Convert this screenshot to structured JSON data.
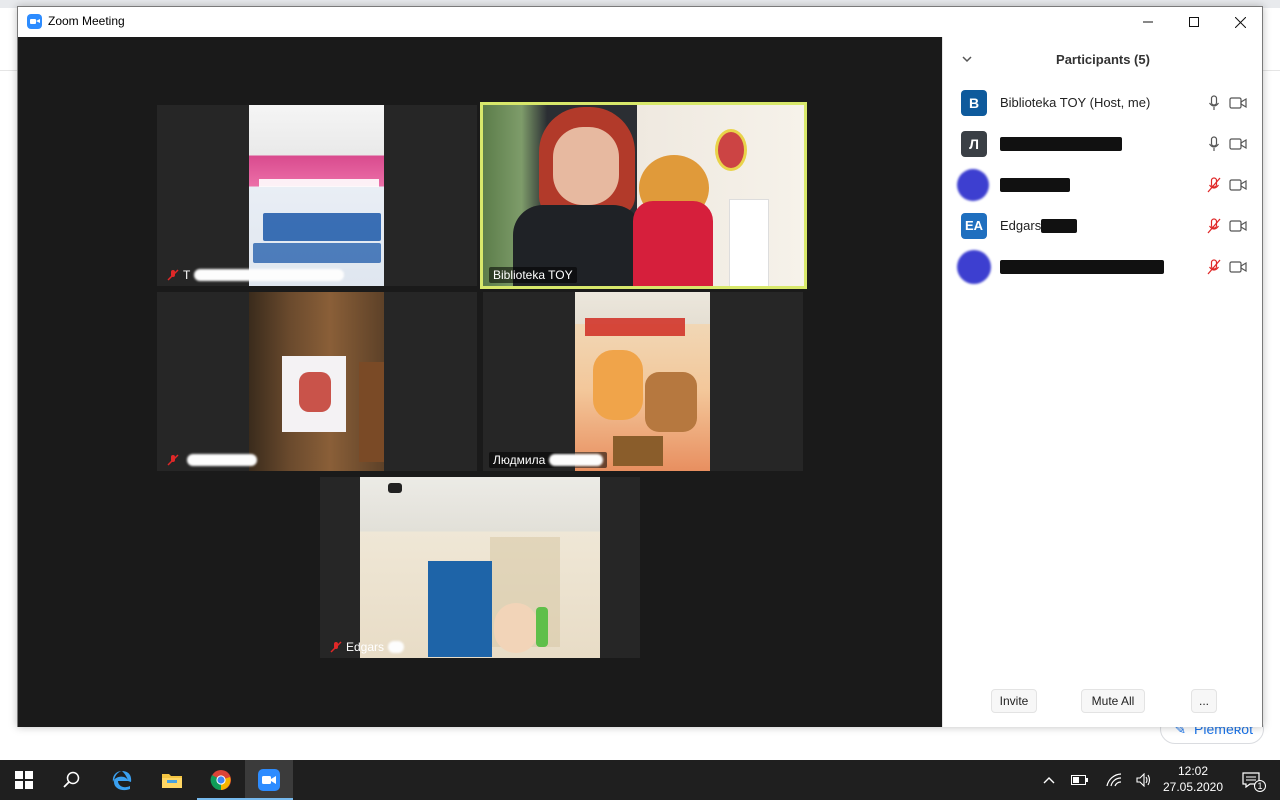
{
  "background": {
    "edit_button_label": "Piemeʀot"
  },
  "window": {
    "title": "Zoom Meeting",
    "min_icon": "minimize-icon",
    "max_icon": "maximize-icon",
    "close_icon": "close-icon"
  },
  "tiles": [
    {
      "name": "T",
      "muted": true,
      "redacted": true
    },
    {
      "name": "Biblioteka TOY",
      "muted": false,
      "active_speaker": true
    },
    {
      "name": "",
      "muted": true,
      "redacted": true
    },
    {
      "name": "Людмила",
      "muted": false,
      "redacted": true
    },
    {
      "name": "Edgars",
      "muted": true,
      "redacted": true
    }
  ],
  "participants_panel": {
    "title": "Participants (5)",
    "items": [
      {
        "initial": "B",
        "name": "Biblioteka TOY (Host, me)",
        "color": "#0e5a9c",
        "mic": "on",
        "video": "on"
      },
      {
        "initial": "Л",
        "name": "",
        "color": "#3a3f45",
        "mic": "on",
        "video": "on",
        "redacted": true
      },
      {
        "initial": "",
        "name": "",
        "color": "#3d3fd0",
        "mic": "muted",
        "video": "on",
        "redacted": true
      },
      {
        "initial": "EA",
        "name": "Edgars",
        "color": "#1f6fbf",
        "mic": "muted",
        "video": "on",
        "redacted": true
      },
      {
        "initial": "",
        "name": "",
        "color": "#3d3fd0",
        "mic": "muted",
        "video": "on",
        "redacted": true
      }
    ],
    "invite_label": "Invite",
    "mute_all_label": "Mute All",
    "more_label": "..."
  },
  "taskbar": {
    "time": "12:02",
    "date": "27.05.2020",
    "notification_count": "1"
  },
  "colors": {
    "active_speaker_border": "#d8e86b",
    "muted_red": "#e02828",
    "zoom_blue": "#2d8cff"
  }
}
